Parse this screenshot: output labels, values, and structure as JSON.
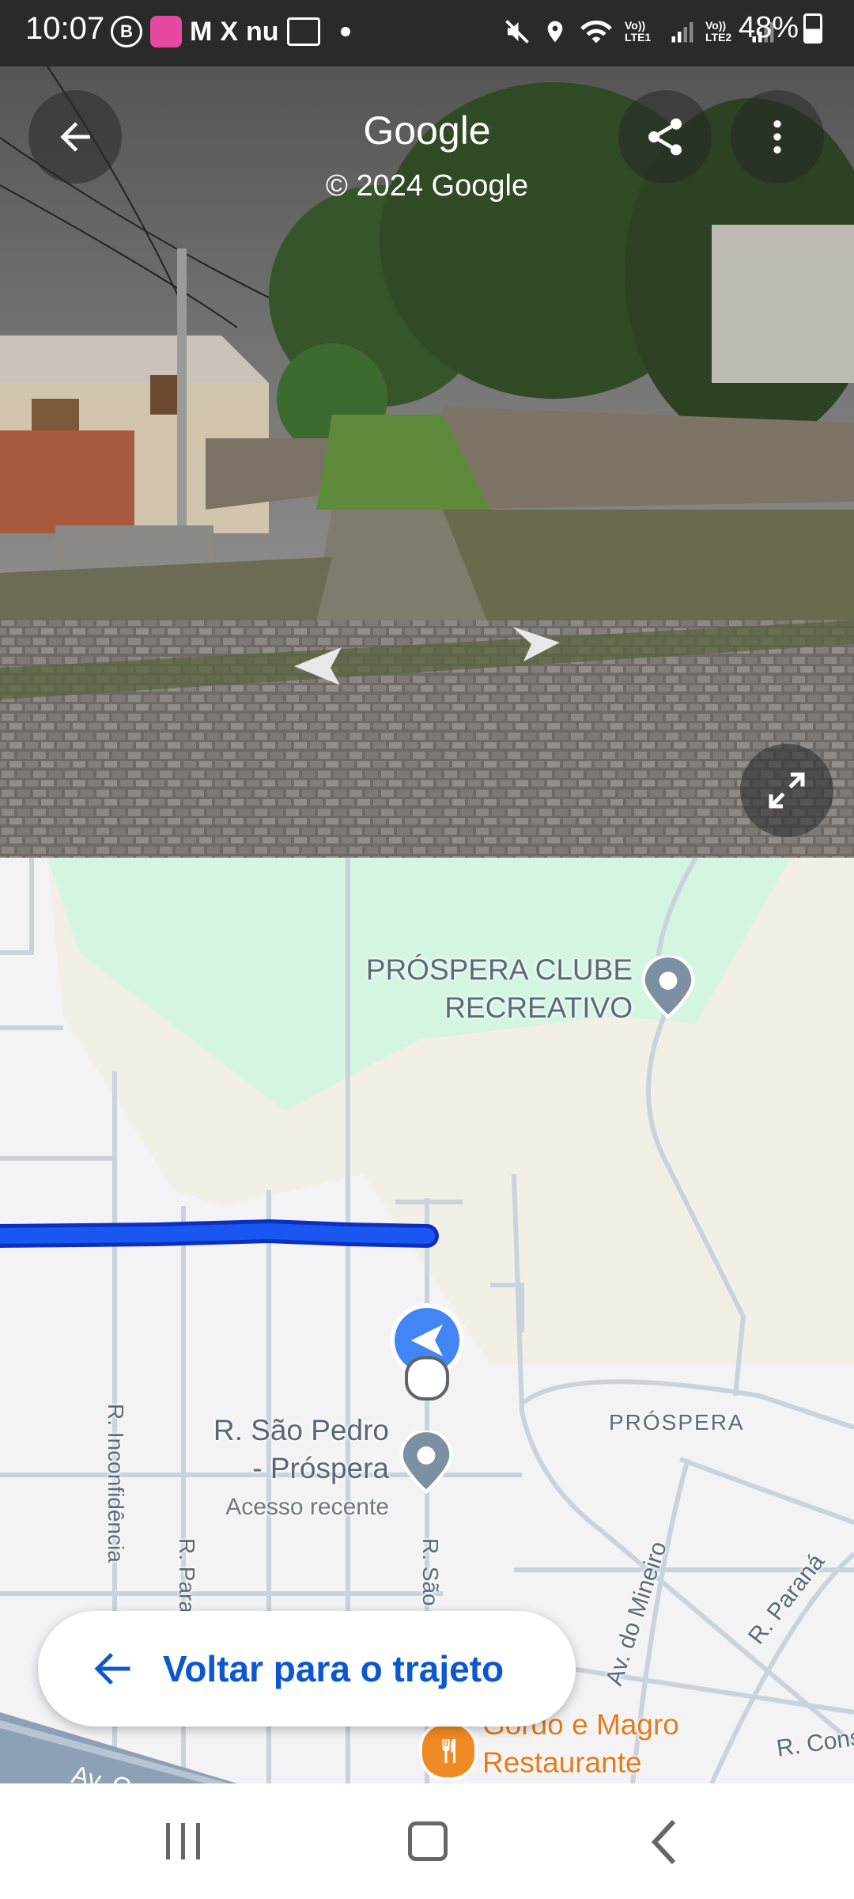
{
  "status_bar": {
    "time": "10:07",
    "notification_icons": [
      "b-icon",
      "app-pink-icon",
      "gmail-icon",
      "x-icon",
      "nu-icon",
      "photo-icon",
      "dot-icon"
    ],
    "sim1": "Vo)) LTE1",
    "sim2": "Vo)) LTE2",
    "battery": "48%"
  },
  "street_view": {
    "title": "Google",
    "copyright": "© 2024 Google"
  },
  "map": {
    "poi_club": "PRÓSPERA CLUBE\nRECREATIVO",
    "poi_club_line1": "PRÓSPERA CLUBE",
    "poi_club_line2": "RECREATIVO",
    "neighborhood": "PRÓSPERA",
    "saved_place_line1": "R. São Pedro",
    "saved_place_line2": "- Próspera",
    "saved_place_sub": "Acesso recente",
    "street_inconfidencia": "R. Inconfidência",
    "street_para": "R. Para",
    "street_sao": "R. São",
    "street_mineiro": "Av. do Mineiro",
    "street_parana": "R. Paraná",
    "street_cons": "R. Cons",
    "street_av": "Av. C",
    "restaurant_line1": "Gordo e Magro",
    "restaurant_line2": "Restaurante",
    "route_color": "#1a56f0",
    "accent": "#4285f4"
  },
  "return_button": {
    "label": "Voltar para o trajeto"
  }
}
